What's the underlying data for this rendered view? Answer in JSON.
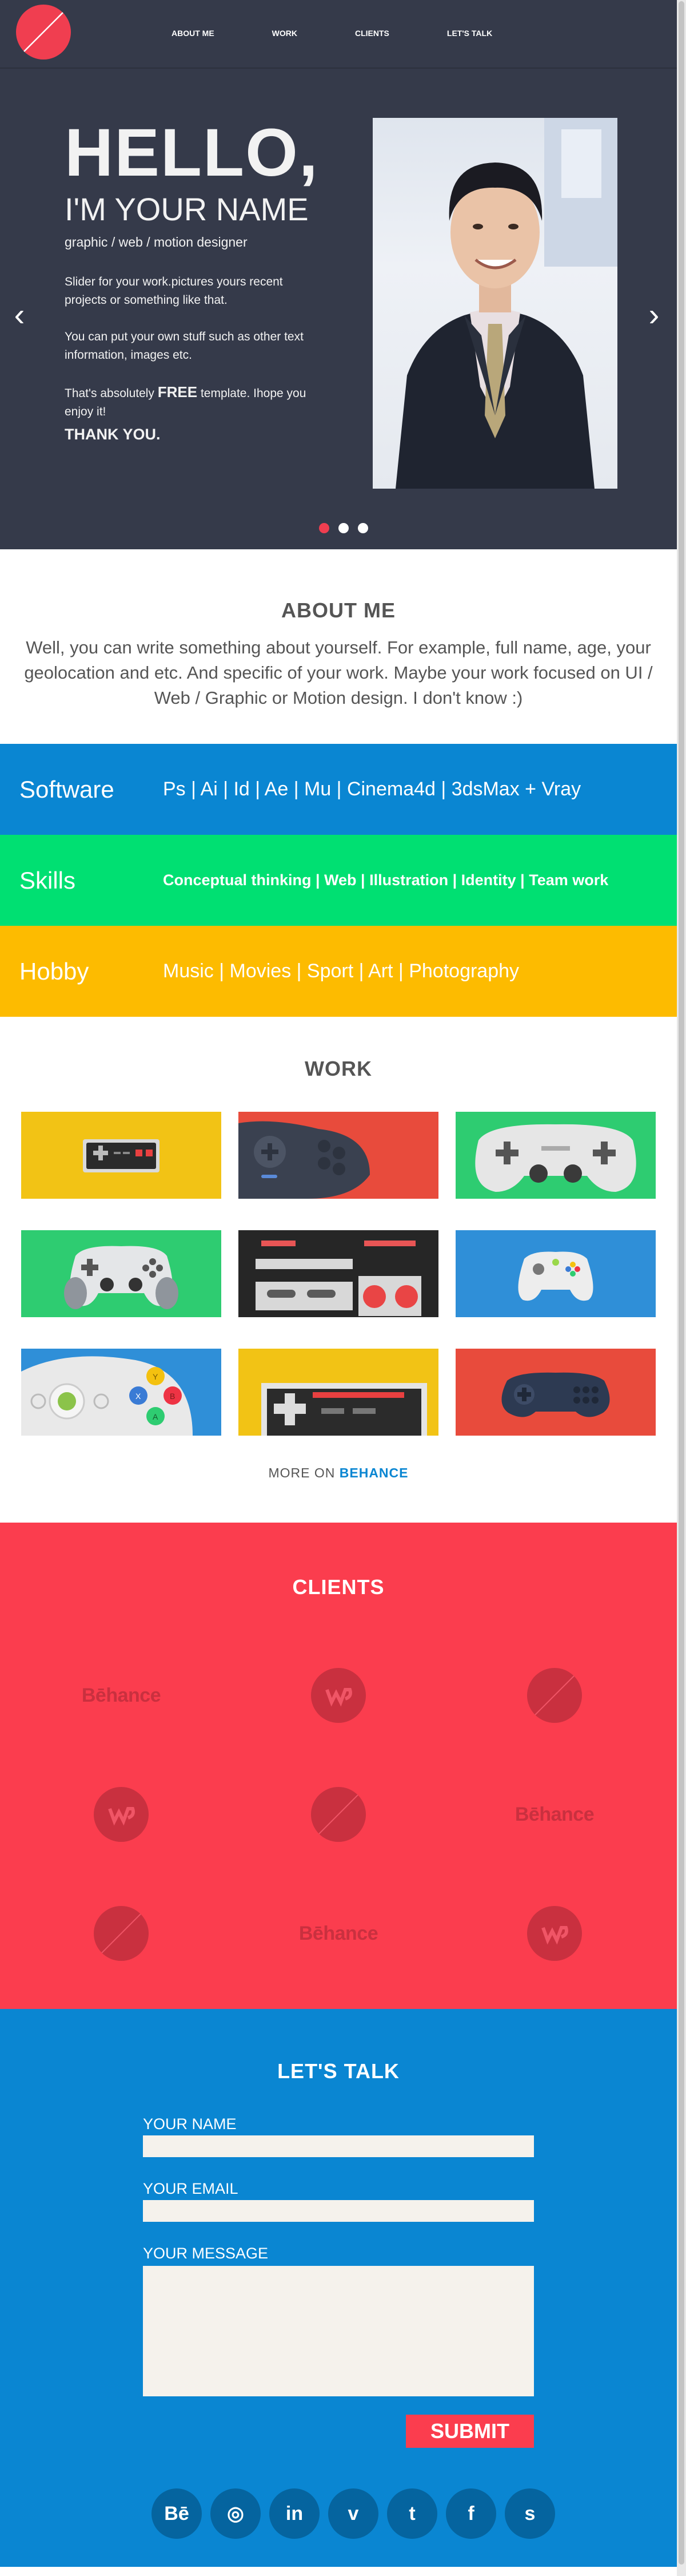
{
  "nav": {
    "items": [
      "ABOUT ME",
      "WORK",
      "CLIENTS",
      "LET'S TALK"
    ]
  },
  "hero": {
    "hello": "HELLO,",
    "sub": "I'M YOUR NAME",
    "role": "graphic / web / motion designer",
    "p1": "Slider for your work.pictures yours recent projects or something like that.",
    "p2": "You can put your own stuff such as other text information, images etc.",
    "p3_pre": "That's absolutely ",
    "p3_bold": "FREE",
    "p3_post": " template. Ihope you enjoy it!",
    "thanks": "THANK YOU.",
    "arrow_left": "‹",
    "arrow_right": "›",
    "slides": 3,
    "active_slide": 1
  },
  "about": {
    "title": "ABOUT ME",
    "text": "Well, you can write something about yourself. For example, full name, age, your geolocation and etc. And specific of your work. Maybe your work focused on UI / Web / Graphic or Motion design. I don't know :)"
  },
  "bands": {
    "software": {
      "label": "Software",
      "value": "Ps | Ai | Id | Ae | Mu | Cinema4d | 3dsMax + Vray"
    },
    "skills": {
      "label": "Skills",
      "value": "Conceptual thinking | Web | Illustration | Identity | Team work"
    },
    "hobby": {
      "label": "Hobby",
      "value": "Music | Movies | Sport | Art | Photography"
    }
  },
  "work": {
    "title": "WORK",
    "more_pre": "MORE ON ",
    "more_link": "BEHANCE"
  },
  "clients": {
    "title": "CLIENTS",
    "behance_word": "Bēhance"
  },
  "contact": {
    "title": "LET'S TALK",
    "name_label": "YOUR NAME",
    "email_label": "YOUR EMAIL",
    "message_label": "YOUR MESSAGE",
    "submit": "SUBMIT",
    "socials": [
      "Bē",
      "◎",
      "in",
      "v",
      "t",
      "f",
      "s"
    ]
  },
  "colors": {
    "dark": "#353a4a",
    "accent_red": "#fb3d4e",
    "blue": "#0a86d2",
    "green": "#00e072",
    "yellow": "#fdbb00"
  }
}
